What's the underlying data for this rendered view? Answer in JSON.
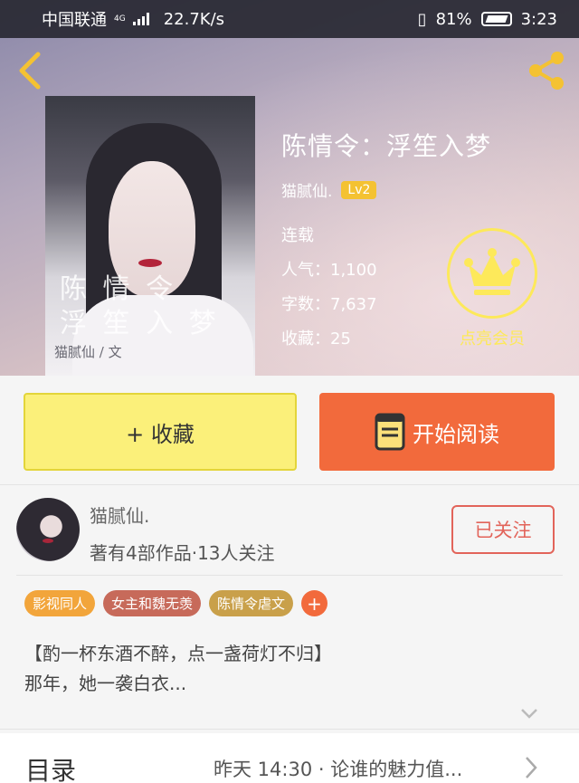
{
  "status_bar": {
    "carrier": "中国联通",
    "network": "4G",
    "speed": "22.7K/s",
    "battery": "81%",
    "time": "3:23"
  },
  "header": {
    "back_icon": "chevron-left-icon",
    "share_icon": "share-icon"
  },
  "book": {
    "title": "陈情令：浮笙入梦",
    "author": "猫腻仙.",
    "level": "Lv2",
    "status": "连载",
    "popularity": "人气：1,100",
    "word_count": "字数：7,637",
    "favorites": "收藏：25"
  },
  "cover": {
    "title_line1": "陈 情 令",
    "title_line2": "浮 笙 入 梦",
    "author": "猫腻仙 / 文"
  },
  "vip": {
    "label": "点亮会员",
    "icon": "crown-icon",
    "color": "#fde95a"
  },
  "actions": {
    "collect": "+ 收藏",
    "read": "开始阅读",
    "read_icon": "book-icon"
  },
  "author_info": {
    "name": "猫腻仙.",
    "stats": "著有4部作品·13人关注",
    "follow": "已关注"
  },
  "tags": [
    {
      "label": "影视同人",
      "color": "#f2a53b"
    },
    {
      "label": "女主和魏无羡",
      "color": "#c76a5a"
    },
    {
      "label": "陈情令虐文",
      "color": "#c9a04a"
    }
  ],
  "tag_add": "+",
  "summary": {
    "line1": "【酌一杯东酒不醉，点一盏荷灯不归】",
    "line2": "那年，她一袭白衣..."
  },
  "toc": {
    "label": "目录",
    "latest": "昨天 14:30 · 论谁的魅力值..."
  },
  "colors": {
    "accent_orange": "#f26a3c",
    "collect_yellow": "#fbf07a",
    "follow_red": "#e2645a"
  }
}
